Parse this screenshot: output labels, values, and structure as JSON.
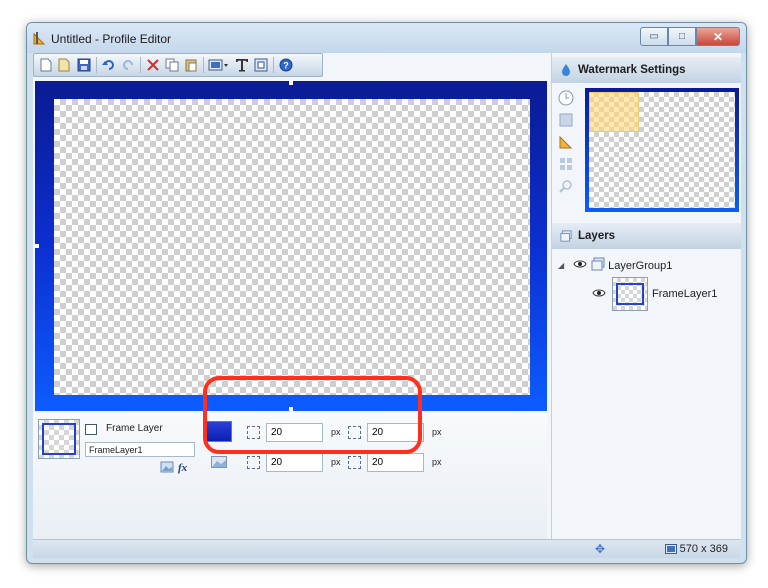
{
  "window": {
    "title": "Untitled - Profile Editor",
    "controls": {
      "minimize": "▭",
      "maximize": "□",
      "close": "✕"
    }
  },
  "toolbar": {
    "icons": [
      "new-icon",
      "open-icon",
      "save-icon",
      "undo-icon",
      "redo-icon",
      "cut-icon",
      "copy-icon",
      "paste-icon",
      "image-layer-icon",
      "text-layer-icon",
      "frame-layer-icon",
      "help-icon"
    ]
  },
  "properties": {
    "layer_type_label": "Frame Layer",
    "layer_name_value": "FrameLayer1",
    "frame_color": "#0a1fbf",
    "top_value": "20",
    "right_value": "20",
    "bottom_value": "20",
    "left_value": "20",
    "unit_label": "px"
  },
  "watermark_panel": {
    "title": "Watermark Settings"
  },
  "layers_panel": {
    "title": "Layers",
    "items": [
      {
        "name": "LayerGroup1"
      },
      {
        "name": "FrameLayer1"
      }
    ]
  },
  "status": {
    "dimensions": "570 x 369"
  },
  "colors": {
    "frame_top": "#0a1b93",
    "frame_bottom": "#0d5cff",
    "highlight": "#ff2f1e"
  }
}
